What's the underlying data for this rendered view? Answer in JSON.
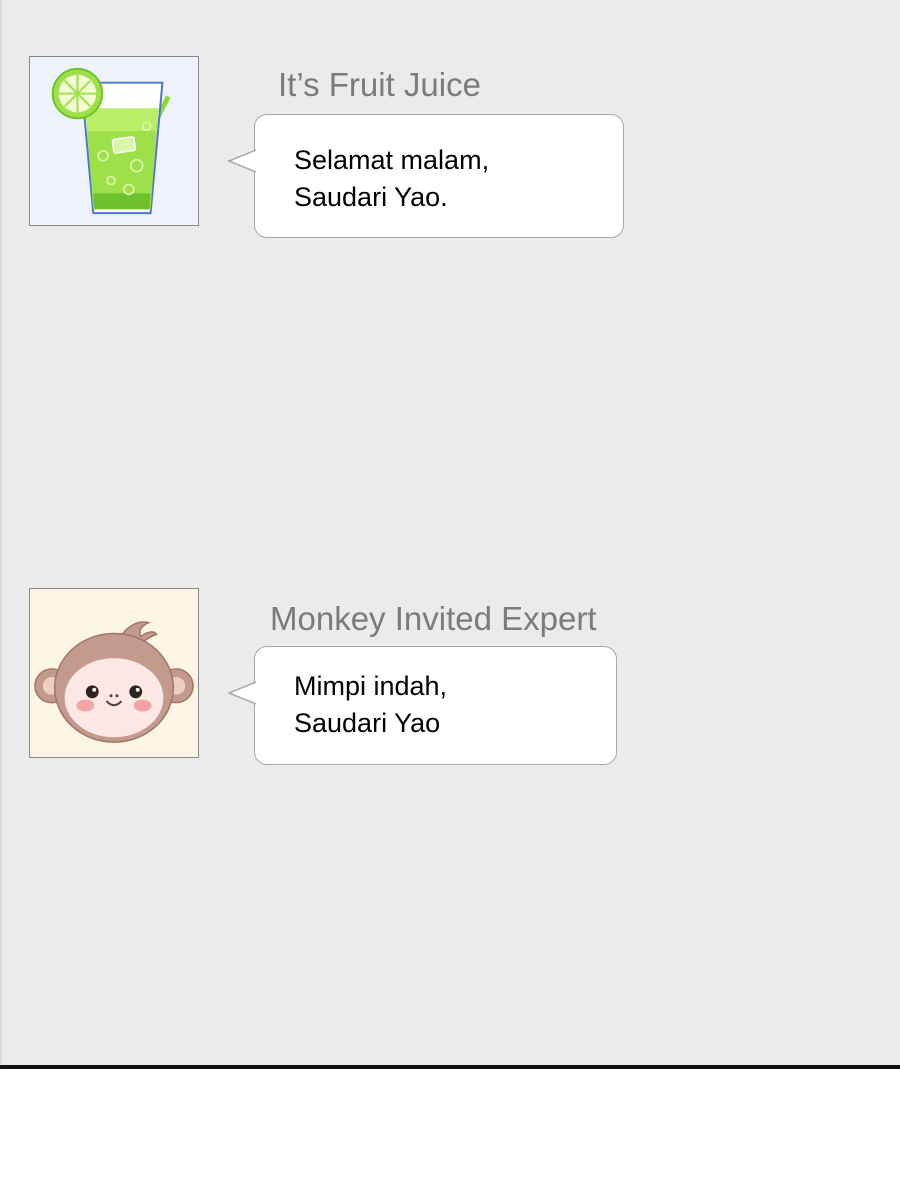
{
  "messages": [
    {
      "sender": "It’s Fruit Juice",
      "avatar_icon": "fruit-juice-glass-icon",
      "lines": [
        "Selamat malam,",
        "Saudari Yao."
      ]
    },
    {
      "sender": "Monkey Invited Expert",
      "avatar_icon": "monkey-face-icon",
      "lines": [
        "Mimpi indah,",
        "Saudari Yao"
      ]
    }
  ],
  "colors": {
    "background": "#ebebeb",
    "bubble": "#ffffff",
    "bubble_border": "#a9a9a9",
    "sender_name": "#7b7b7b",
    "juice_green": "#8fd63a",
    "monkey_brown": "#c49a8c"
  }
}
